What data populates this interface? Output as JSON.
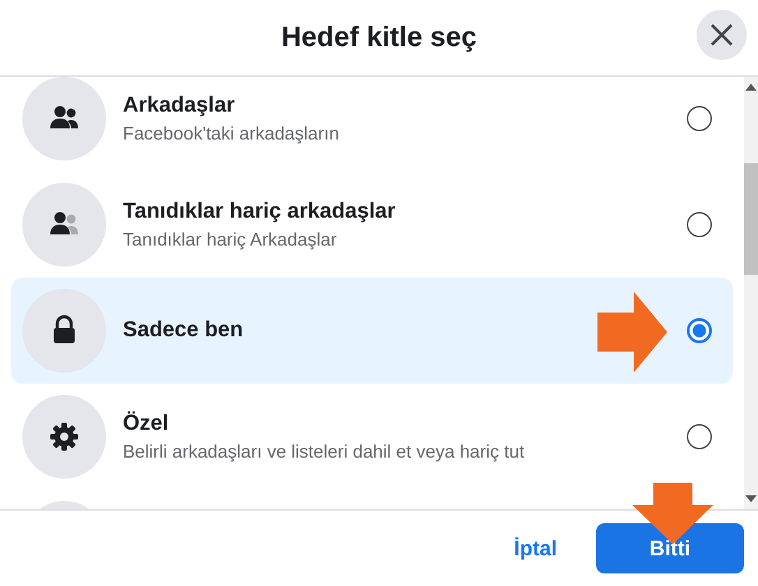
{
  "dialog": {
    "title": "Hedef kitle seç"
  },
  "options": [
    {
      "kind": "friends",
      "title": "Arkadaşlar",
      "subtitle": "Facebook'taki arkadaşların",
      "selected": false
    },
    {
      "kind": "friends-except",
      "title": "Tanıdıklar hariç arkadaşlar",
      "subtitle": "Tanıdıklar hariç Arkadaşlar",
      "selected": false
    },
    {
      "kind": "lock",
      "title": "Sadece ben",
      "selected": true
    },
    {
      "kind": "gear",
      "title": "Özel",
      "subtitle": "Belirli arkadaşları ve listeleri dahil et veya hariç tut",
      "selected": false
    }
  ],
  "footer": {
    "cancel": "İptal",
    "done": "Bitti"
  }
}
